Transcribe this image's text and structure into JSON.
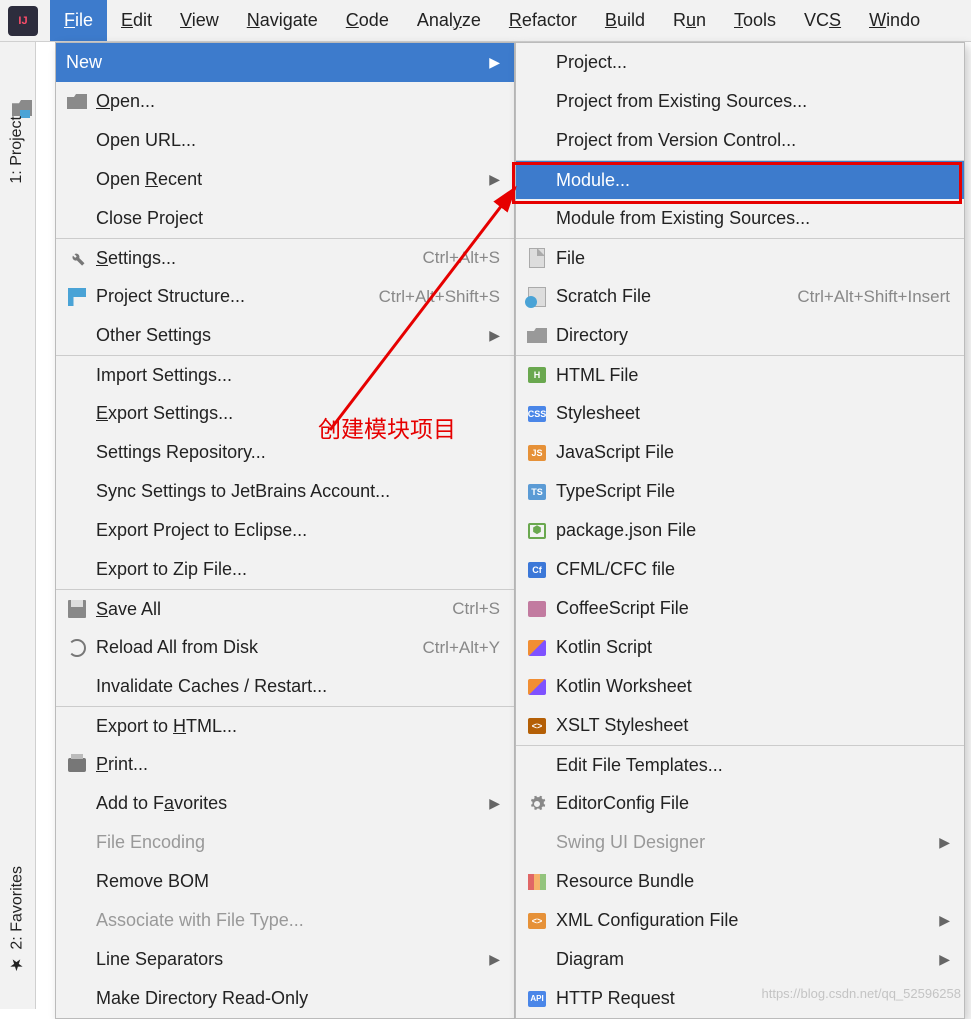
{
  "menubar": [
    "File",
    "Edit",
    "View",
    "Navigate",
    "Code",
    "Analyze",
    "Refactor",
    "Build",
    "Run",
    "Tools",
    "VCS",
    "Windo"
  ],
  "menubar_mnemonic": [
    0,
    0,
    0,
    0,
    0,
    4,
    0,
    0,
    1,
    0,
    2,
    0
  ],
  "sidebar": {
    "project": "1: Project",
    "favorites": "2: Favorites"
  },
  "file_menu": [
    {
      "label": "New",
      "icon": "",
      "selected": true,
      "arrow": true
    },
    {
      "label": "Open...",
      "icon": "folder",
      "mn": 0
    },
    {
      "label": "Open URL...",
      "indent": true
    },
    {
      "label": "Open Recent",
      "indent": true,
      "mn": 5,
      "arrow": true
    },
    {
      "label": "Close Project",
      "indent": true
    },
    {
      "label": "Settings...",
      "icon": "wrench",
      "sep": true,
      "mn": 0,
      "shortcut": "Ctrl+Alt+S"
    },
    {
      "label": "Project Structure...",
      "icon": "structure",
      "shortcut": "Ctrl+Alt+Shift+S"
    },
    {
      "label": "Other Settings",
      "indent": true,
      "arrow": true
    },
    {
      "label": "Import Settings...",
      "indent": true,
      "sep": true
    },
    {
      "label": "Export Settings...",
      "indent": true,
      "mn": 0
    },
    {
      "label": "Settings Repository...",
      "indent": true
    },
    {
      "label": "Sync Settings to JetBrains Account...",
      "indent": true
    },
    {
      "label": "Export Project to Eclipse...",
      "indent": true
    },
    {
      "label": "Export to Zip File...",
      "indent": true
    },
    {
      "label": "Save All",
      "icon": "save",
      "sep": true,
      "mn": 0,
      "shortcut": "Ctrl+S"
    },
    {
      "label": "Reload All from Disk",
      "icon": "reload",
      "shortcut": "Ctrl+Alt+Y"
    },
    {
      "label": "Invalidate Caches / Restart...",
      "indent": true
    },
    {
      "label": "Export to HTML...",
      "indent": true,
      "sep": true,
      "mn": 10
    },
    {
      "label": "Print...",
      "icon": "print",
      "mn": 0
    },
    {
      "label": "Add to Favorites",
      "indent": true,
      "mn": 8,
      "arrow": true
    },
    {
      "label": "File Encoding",
      "indent": true,
      "disabled": true
    },
    {
      "label": "Remove BOM",
      "indent": true
    },
    {
      "label": "Associate with File Type...",
      "indent": true,
      "disabled": true
    },
    {
      "label": "Line Separators",
      "indent": true,
      "arrow": true
    },
    {
      "label": "Make Directory Read-Only",
      "indent": true
    }
  ],
  "new_menu": [
    {
      "label": "Project...",
      "indent": true
    },
    {
      "label": "Project from Existing Sources...",
      "indent": true
    },
    {
      "label": "Project from Version Control...",
      "indent": true
    },
    {
      "label": "Module...",
      "indent": true,
      "selected": true,
      "sep": true
    },
    {
      "label": "Module from Existing Sources...",
      "indent": true
    },
    {
      "label": "File",
      "icon": "file",
      "sep": true
    },
    {
      "label": "Scratch File",
      "icon": "scratch",
      "shortcut": "Ctrl+Alt+Shift+Insert"
    },
    {
      "label": "Directory",
      "icon": "folder-grey"
    },
    {
      "label": "HTML File",
      "icon": "html",
      "sep": true,
      "txt": "H"
    },
    {
      "label": "Stylesheet",
      "icon": "css",
      "txt": "CSS"
    },
    {
      "label": "JavaScript File",
      "icon": "js",
      "txt": "JS"
    },
    {
      "label": "TypeScript File",
      "icon": "ts",
      "txt": "TS"
    },
    {
      "label": "package.json File",
      "icon": "node",
      "txt": "⬢"
    },
    {
      "label": "CFML/CFC file",
      "icon": "cf",
      "txt": "Cf"
    },
    {
      "label": "CoffeeScript File",
      "icon": "coffee",
      "txt": ""
    },
    {
      "label": "Kotlin Script",
      "icon": "kotlin",
      "txt": ""
    },
    {
      "label": "Kotlin Worksheet",
      "icon": "kotlin",
      "txt": ""
    },
    {
      "label": "XSLT Stylesheet",
      "icon": "xslt",
      "txt": "<>"
    },
    {
      "label": "Edit File Templates...",
      "indent": true,
      "sep": true
    },
    {
      "label": "EditorConfig File",
      "icon": "gear"
    },
    {
      "label": "Swing UI Designer",
      "indent": true,
      "disabled": true,
      "arrow": true
    },
    {
      "label": "Resource Bundle",
      "icon": "bundle"
    },
    {
      "label": "XML Configuration File",
      "icon": "xml",
      "txt": "<>",
      "arrow": true
    },
    {
      "label": "Diagram",
      "indent": true,
      "arrow": true
    },
    {
      "label": "HTTP Request",
      "icon": "api",
      "txt": "API"
    }
  ],
  "annotation": "创建模块项目",
  "watermark": "https://blog.csdn.net/qq_52596258"
}
